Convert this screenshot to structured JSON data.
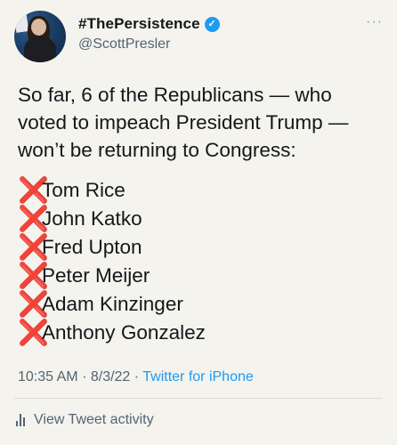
{
  "tweet": {
    "display_name": "#ThePersistence",
    "handle": "@ScottPresler",
    "text": "So far, 6 of the Republicans — who voted to impeach President Trump — won’t be returning to Congress:",
    "list": [
      "Tom Rice",
      "John Katko",
      "Fred Upton",
      "Peter Meijer",
      "Adam Kinzinger",
      "Anthony Gonzalez"
    ],
    "list_marker": "❌",
    "time": "10:35 AM",
    "date": "8/3/22",
    "separator": "·",
    "source": "Twitter for iPhone",
    "activity_label": "View Tweet activity",
    "more_label": "···"
  },
  "icons": {
    "verified": "verified-badge-icon",
    "more": "more-options-icon",
    "activity": "bar-chart-icon"
  },
  "colors": {
    "background": "#f4f3ee",
    "accent": "#1d9bf0",
    "secondary_text": "#536471",
    "cross": "#dd2e44"
  }
}
